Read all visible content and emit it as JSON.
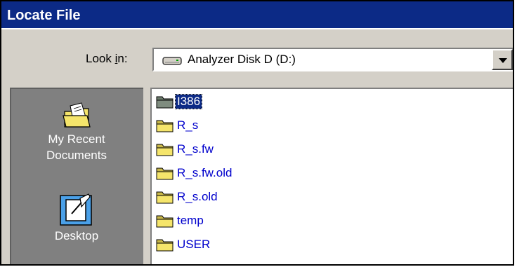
{
  "window": {
    "title": "Locate File"
  },
  "look_in": {
    "label_prefix": "Look ",
    "label_accel": "i",
    "label_suffix": "n:",
    "value": "Analyzer Disk D (D:)",
    "icon": "drive-icon"
  },
  "places": [
    {
      "label_line1": "My Recent",
      "label_line2": "Documents",
      "icon": "recent-documents-icon"
    },
    {
      "label_line1": "Desktop",
      "label_line2": "",
      "icon": "desktop-icon"
    }
  ],
  "files": [
    {
      "name": "I386",
      "selected": true
    },
    {
      "name": "R_s",
      "selected": false
    },
    {
      "name": "R_s.fw",
      "selected": false
    },
    {
      "name": "R_s.fw.old",
      "selected": false
    },
    {
      "name": "R_s.old",
      "selected": false
    },
    {
      "name": "temp",
      "selected": false
    },
    {
      "name": "USER",
      "selected": false
    }
  ],
  "colors": {
    "titlebar": "#0c2a86",
    "dialog": "#d4d0c8",
    "places_panel": "#808080",
    "file_text": "#0000cc",
    "folder": "#f5e56b"
  }
}
